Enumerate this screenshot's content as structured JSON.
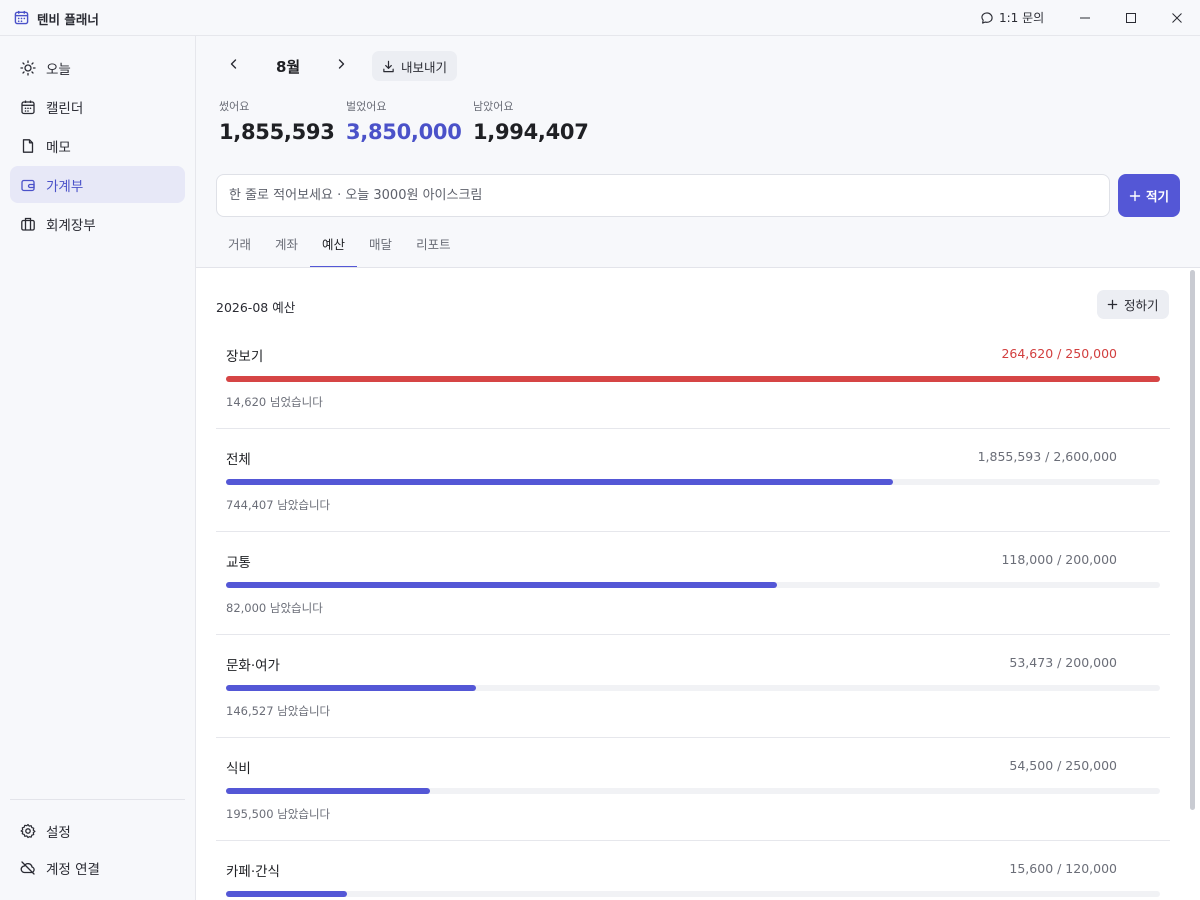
{
  "app": {
    "title": "텐비 플래너",
    "inquiry_label": "1:1 문의"
  },
  "sidebar": {
    "items": [
      {
        "label": "오늘",
        "icon": "sun-icon"
      },
      {
        "label": "캘린더",
        "icon": "calendar-icon"
      },
      {
        "label": "메모",
        "icon": "document-icon"
      },
      {
        "label": "가계부",
        "icon": "wallet-icon",
        "active": true
      },
      {
        "label": "회계장부",
        "icon": "briefcase-icon"
      }
    ],
    "bottom": [
      {
        "label": "설정",
        "icon": "gear-icon"
      },
      {
        "label": "계정 연결",
        "icon": "cloud-off-icon"
      }
    ]
  },
  "header": {
    "month": "8월",
    "export_label": "내보내기",
    "stats": {
      "spent_label": "썼어요",
      "spent_value": "1,855,593",
      "earned_label": "벌었어요",
      "earned_value": "3,850,000",
      "left_label": "남았어요",
      "left_value": "1,994,407"
    },
    "quick_input_placeholder": "한 줄로 적어보세요 · 오늘 3000원 아이스크림",
    "write_label": "적기"
  },
  "tabs": [
    "거래",
    "계좌",
    "예산",
    "매달",
    "리포트"
  ],
  "active_tab": "예산",
  "budget": {
    "title": "2026-08 예산",
    "set_label": "정하기",
    "items": [
      {
        "name": "장보기",
        "amount": "264,620 / 250,000",
        "ratio": 1.0,
        "over": true,
        "note": "14,620 넘었습니다"
      },
      {
        "name": "전체",
        "amount": "1,855,593 / 2,600,000",
        "ratio": 0.7137,
        "over": false,
        "note": "744,407 남았습니다"
      },
      {
        "name": "교통",
        "amount": "118,000 / 200,000",
        "ratio": 0.59,
        "over": false,
        "note": "82,000 남았습니다"
      },
      {
        "name": "문화·여가",
        "amount": "53,473 / 200,000",
        "ratio": 0.2674,
        "over": false,
        "note": "146,527 남았습니다"
      },
      {
        "name": "식비",
        "amount": "54,500 / 250,000",
        "ratio": 0.218,
        "over": false,
        "note": "195,500 남았습니다"
      },
      {
        "name": "카페·간식",
        "amount": "15,600 / 120,000",
        "ratio": 0.13,
        "over": false,
        "note": ""
      }
    ]
  },
  "colors": {
    "accent": "#5457d6",
    "over": "#d64545",
    "over_text": "#d23f3f"
  }
}
